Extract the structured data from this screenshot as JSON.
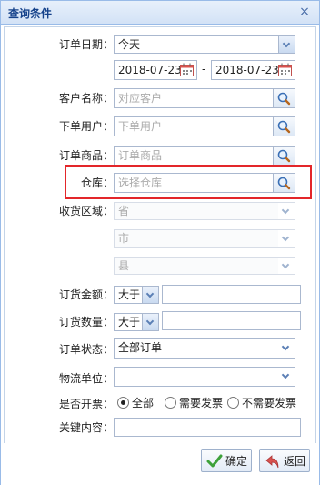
{
  "window": {
    "title": "查询条件",
    "close_glyph": "×"
  },
  "order_date": {
    "label": "订单日期：",
    "value": "今天",
    "start": "2018-07-23",
    "separator": "-",
    "end": "2018-07-23"
  },
  "customer": {
    "label": "客户名称：",
    "placeholder": "对应客户"
  },
  "order_user": {
    "label": "下单用户：",
    "placeholder": "下单用户"
  },
  "order_goods": {
    "label": "订单商品：",
    "placeholder": "订单商品"
  },
  "warehouse": {
    "label": "仓库：",
    "placeholder": "选择仓库"
  },
  "region": {
    "label": "收货区域：",
    "province": "省",
    "city": "市",
    "county": "县"
  },
  "amount": {
    "label": "订货金额：",
    "operator": "大于",
    "value": ""
  },
  "quantity": {
    "label": "订货数量：",
    "operator": "大于",
    "value": ""
  },
  "status": {
    "label": "订单状态：",
    "value": "全部订单"
  },
  "logistics": {
    "label": "物流单位：",
    "value": ""
  },
  "invoice": {
    "label": "是否开票：",
    "options": [
      "全部",
      "需要发票",
      "不需要发票"
    ],
    "selected": 0
  },
  "keyword": {
    "label": "关键内容：",
    "value": ""
  },
  "buttons": {
    "confirm": "确定",
    "back": "返回"
  },
  "colors": {
    "highlight": "#e3262a",
    "accent": "#15428b",
    "border": "#99bbe8"
  }
}
